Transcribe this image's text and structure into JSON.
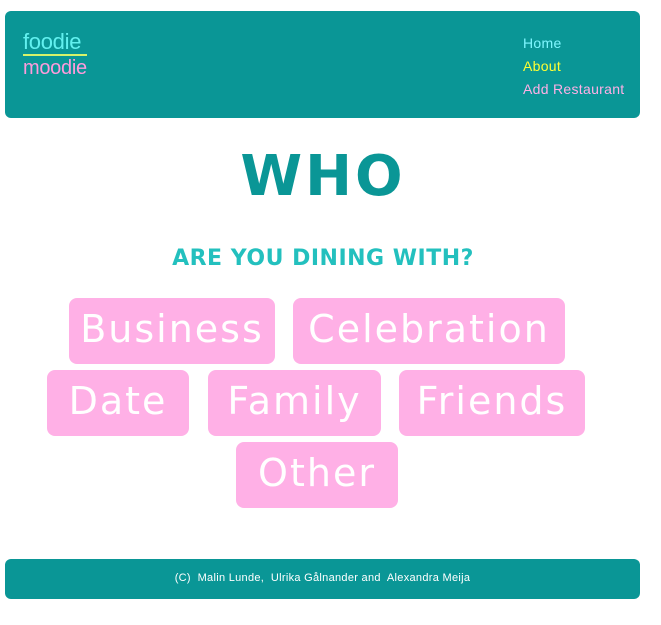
{
  "header": {
    "logo": {
      "line1": "foodie",
      "line2": "moodie"
    },
    "nav": [
      {
        "label": "Home",
        "color": "#7ff7ff"
      },
      {
        "label": "About",
        "color": "#ffff33"
      },
      {
        "label": "Add Restaurant",
        "color": "#ffb0e6"
      }
    ]
  },
  "main": {
    "title": "WHO",
    "subtitle": "ARE YOU DINING WITH?",
    "choices": [
      {
        "label": "Business"
      },
      {
        "label": "Celebration"
      },
      {
        "label": "Date"
      },
      {
        "label": "Family"
      },
      {
        "label": "Friends"
      },
      {
        "label": "Other"
      }
    ]
  },
  "footer": {
    "text": "(C)  Malin Lunde,  Ulrika Gålnander and  Alexandra Meija"
  },
  "colors": {
    "brand_teal": "#0a9696",
    "accent_teal": "#23c0be",
    "button_pink": "#ffb0e6"
  }
}
